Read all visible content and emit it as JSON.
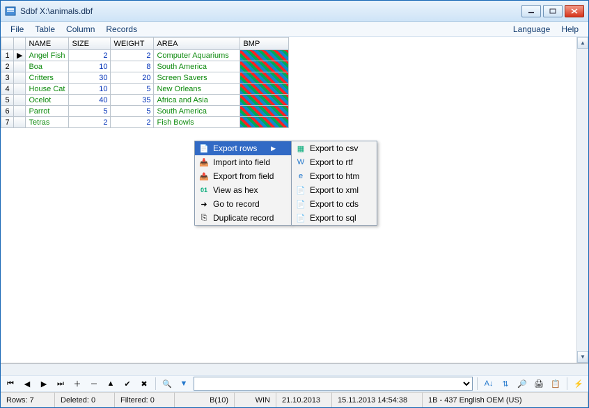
{
  "window": {
    "title": "Sdbf X:\\animals.dbf"
  },
  "menu": {
    "file": "File",
    "table": "Table",
    "column": "Column",
    "records": "Records",
    "language": "Language",
    "help": "Help"
  },
  "columns": {
    "name": "NAME",
    "size": "SIZE",
    "weight": "WEIGHT",
    "area": "AREA",
    "bmp": "BMP"
  },
  "rows": [
    {
      "n": "1",
      "name": "Angel Fish",
      "size": "2",
      "weight": "2",
      "area": "Computer Aquariums"
    },
    {
      "n": "2",
      "name": "Boa",
      "size": "10",
      "weight": "8",
      "area": "South America"
    },
    {
      "n": "3",
      "name": "Critters",
      "size": "30",
      "weight": "20",
      "area": "Screen Savers"
    },
    {
      "n": "4",
      "name": "House Cat",
      "size": "10",
      "weight": "5",
      "area": "New Orleans"
    },
    {
      "n": "5",
      "name": "Ocelot",
      "size": "40",
      "weight": "35",
      "area": "Africa and Asia"
    },
    {
      "n": "6",
      "name": "Parrot",
      "size": "5",
      "weight": "5",
      "area": "South America"
    },
    {
      "n": "7",
      "name": "Tetras",
      "size": "2",
      "weight": "2",
      "area": "Fish Bowls"
    }
  ],
  "context_menu": {
    "export_rows": "Export rows",
    "import_field": "Import into field",
    "export_field": "Export from field",
    "view_hex": "View as hex",
    "goto_record": "Go to record",
    "duplicate": "Duplicate record"
  },
  "submenu": {
    "csv": "Export to csv",
    "rtf": "Export to rtf",
    "htm": "Export to htm",
    "xml": "Export to xml",
    "cds": "Export to cds",
    "sql": "Export to sql"
  },
  "status": {
    "rows": "Rows: 7",
    "deleted": "Deleted: 0",
    "filtered": "Filtered: 0",
    "fmt": "B(10)",
    "enc": "WIN",
    "date1": "21.10.2013",
    "date2": "15.11.2013 14:54:38",
    "cp": "1B - 437 English OEM (US)"
  }
}
